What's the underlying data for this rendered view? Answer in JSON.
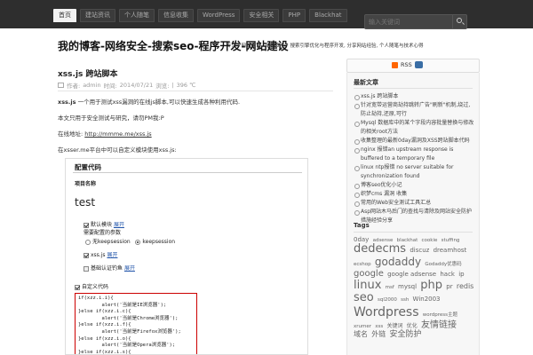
{
  "nav": {
    "items": [
      "首页",
      "建站资讯",
      "个人随笔",
      "信息收集",
      "WordPress",
      "安全相关",
      "PHP",
      "Blackhat"
    ],
    "active_index": 0,
    "search_placeholder": "输入关键词"
  },
  "header": {
    "title": "我的博客-网络安全-搜索seo-程序开发-网站建设",
    "description": "专注于网站建设、网络安全、搜索引擎优化与程序开发, 分享网站经验, 个人随笔与技术心得"
  },
  "post": {
    "title": "xss.js 跨站脚本",
    "meta": {
      "author_label": "作者:",
      "author": "admin",
      "date_label": "时间:",
      "date": "2014/07/21",
      "category_label": "浏览:",
      "views": "396 ℃"
    },
    "p1_bold": "xss.js",
    "p1_text": " 一个用于测试xss漏洞的在线js脚本,可以快速生成各种利用代码.",
    "p2": "本文只用于安全测试与研究，请勿PM我:P",
    "p3_label": "在线地址: ",
    "p3_link": "http://mmme.me/xss.js",
    "p4": "在xsser.me平台中可以自定义模块使用xss.js:"
  },
  "screenshot": {
    "heading": "配置代码",
    "project_label": "项目名称",
    "project_value": "test",
    "opt1_label": "默认模块",
    "opt1_link": "展开",
    "opt1_sub": "需要配置的参数",
    "radio1": "无keepsession",
    "radio2": "keepsession",
    "opt2_label": "xss.js",
    "opt2_link": "展开",
    "opt3_label": "基础认证钓鱼",
    "opt3_link": "展开",
    "custom_label": "自定义代码",
    "code_lines": [
      "if(xzz.i.i){",
      "        alert('当前是IE浏览器');",
      "}else if(xzz.i.c){",
      "        alert('当前是Chrome浏览器');",
      "}else if(xzz.i.f){",
      "        alert('当前是Firefox浏览器');",
      "}else if(xzz.i.o){",
      "        alert('当前是Opera浏览器');",
      "}else if(xzz.i.s){"
    ]
  },
  "sidebar": {
    "rss_label": "RSS",
    "rss_sub": "订阅",
    "recent_title": "最新文章",
    "recent": [
      [
        "xss.js 跨站脚本"
      ],
      [
        "针对宽带运营商劫持跳转广告\"刷新\"机制,绕过,防止劫持,还原,可行"
      ],
      [
        "Mysql 数据库中的某个字段内容批量替换与修改的相关root方法"
      ],
      [
        "收集整理的最新0day漏洞及XSS跨站脚本代码"
      ],
      [
        "nginx 报错an upstream response is",
        "buffered to a temporary file"
      ],
      [
        "linux ntp报错 no server suitable for",
        "synchronization found"
      ],
      [
        "博客seo优化小记"
      ],
      [
        "织梦cms 漏洞 收集"
      ],
      [
        "常用的Web安全测试工具汇总"
      ],
      [
        "Asp网站木马后门的查找与清除及网站安全防护措施经验分享"
      ]
    ],
    "tags_title": "Tags",
    "tags": [
      {
        "t": "0day",
        "s": 7
      },
      {
        "t": "adsense",
        "s": 5.5
      },
      {
        "t": "blackhat",
        "s": 5.5
      },
      {
        "t": "cookie",
        "s": 5.5
      },
      {
        "t": "stuffing",
        "s": 5.5
      },
      {
        "t": "dedecms",
        "s": 13
      },
      {
        "t": "discuz",
        "s": 7
      },
      {
        "t": "dreamhost",
        "s": 7
      },
      {
        "t": "ecshop",
        "s": 5.5
      },
      {
        "t": "godaddy",
        "s": 12
      },
      {
        "t": "Godaddy优惠码",
        "s": 5.5
      },
      {
        "t": "google",
        "s": 10
      },
      {
        "t": "google adsense",
        "s": 7
      },
      {
        "t": "hack",
        "s": 7
      },
      {
        "t": "ip",
        "s": 7
      },
      {
        "t": "linux",
        "s": 13
      },
      {
        "t": "msf",
        "s": 5.5
      },
      {
        "t": "mysql",
        "s": 7
      },
      {
        "t": "php",
        "s": 13
      },
      {
        "t": "pr",
        "s": 7
      },
      {
        "t": "redis",
        "s": 8
      },
      {
        "t": "seo",
        "s": 13
      },
      {
        "t": "sql2000",
        "s": 5.5
      },
      {
        "t": "ssh",
        "s": 5.5
      },
      {
        "t": "Win2003",
        "s": 7
      },
      {
        "t": "Wordpress",
        "s": 14
      },
      {
        "t": "wordpress主题",
        "s": 5.5
      },
      {
        "t": "xrumer",
        "s": 5.5
      },
      {
        "t": "xss",
        "s": 5.5
      },
      {
        "t": "关键词",
        "s": 6
      },
      {
        "t": "优化",
        "s": 6
      },
      {
        "t": "友情链接",
        "s": 10
      },
      {
        "t": "域名",
        "s": 8
      },
      {
        "t": "外链",
        "s": 8
      },
      {
        "t": "安全防护",
        "s": 9
      }
    ]
  }
}
